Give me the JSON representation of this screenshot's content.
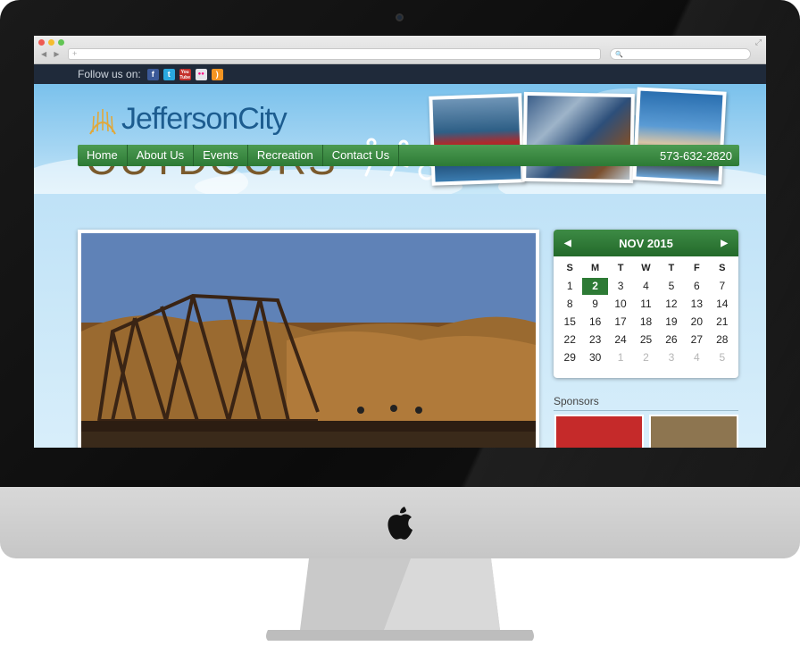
{
  "browser": {
    "url_placeholder": "+",
    "nav_arrows": "◀ ▶",
    "expand_glyph": "⤢",
    "search_glyph": "🔍"
  },
  "site": {
    "follow_label": "Follow us on:",
    "social": [
      {
        "name": "facebook-icon",
        "glyph": "f",
        "color": "#3b5998"
      },
      {
        "name": "twitter-icon",
        "glyph": "t",
        "color": "#2aa9e0"
      },
      {
        "name": "youtube-icon",
        "glyph": "You Tube",
        "color": "#c4302b"
      },
      {
        "name": "flickr-icon",
        "glyph": "●●",
        "color": "#e4e4ea"
      },
      {
        "name": "rss-icon",
        "glyph": ")",
        "color": "#f39422"
      }
    ],
    "logo_top": "JeffersonCity",
    "logo_bottom": "OUTDOORS",
    "nav": [
      "Home",
      "About Us",
      "Events",
      "Recreation",
      "Contact Us"
    ],
    "phone": "573-632-2820"
  },
  "calendar": {
    "month_label": "NOV 2015",
    "prev": "◀",
    "next": "▶",
    "weekdays": [
      "S",
      "M",
      "T",
      "W",
      "T",
      "F",
      "S"
    ],
    "days": [
      [
        "1",
        "2",
        "3",
        "4",
        "5",
        "6",
        "7"
      ],
      [
        "8",
        "9",
        "10",
        "11",
        "12",
        "13",
        "14"
      ],
      [
        "15",
        "16",
        "17",
        "18",
        "19",
        "20",
        "21"
      ],
      [
        "22",
        "23",
        "24",
        "25",
        "26",
        "27",
        "28"
      ],
      [
        "29",
        "30",
        "1",
        "2",
        "3",
        "4",
        "5"
      ]
    ],
    "today": "2"
  },
  "sponsors": {
    "heading": "Sponsors"
  }
}
